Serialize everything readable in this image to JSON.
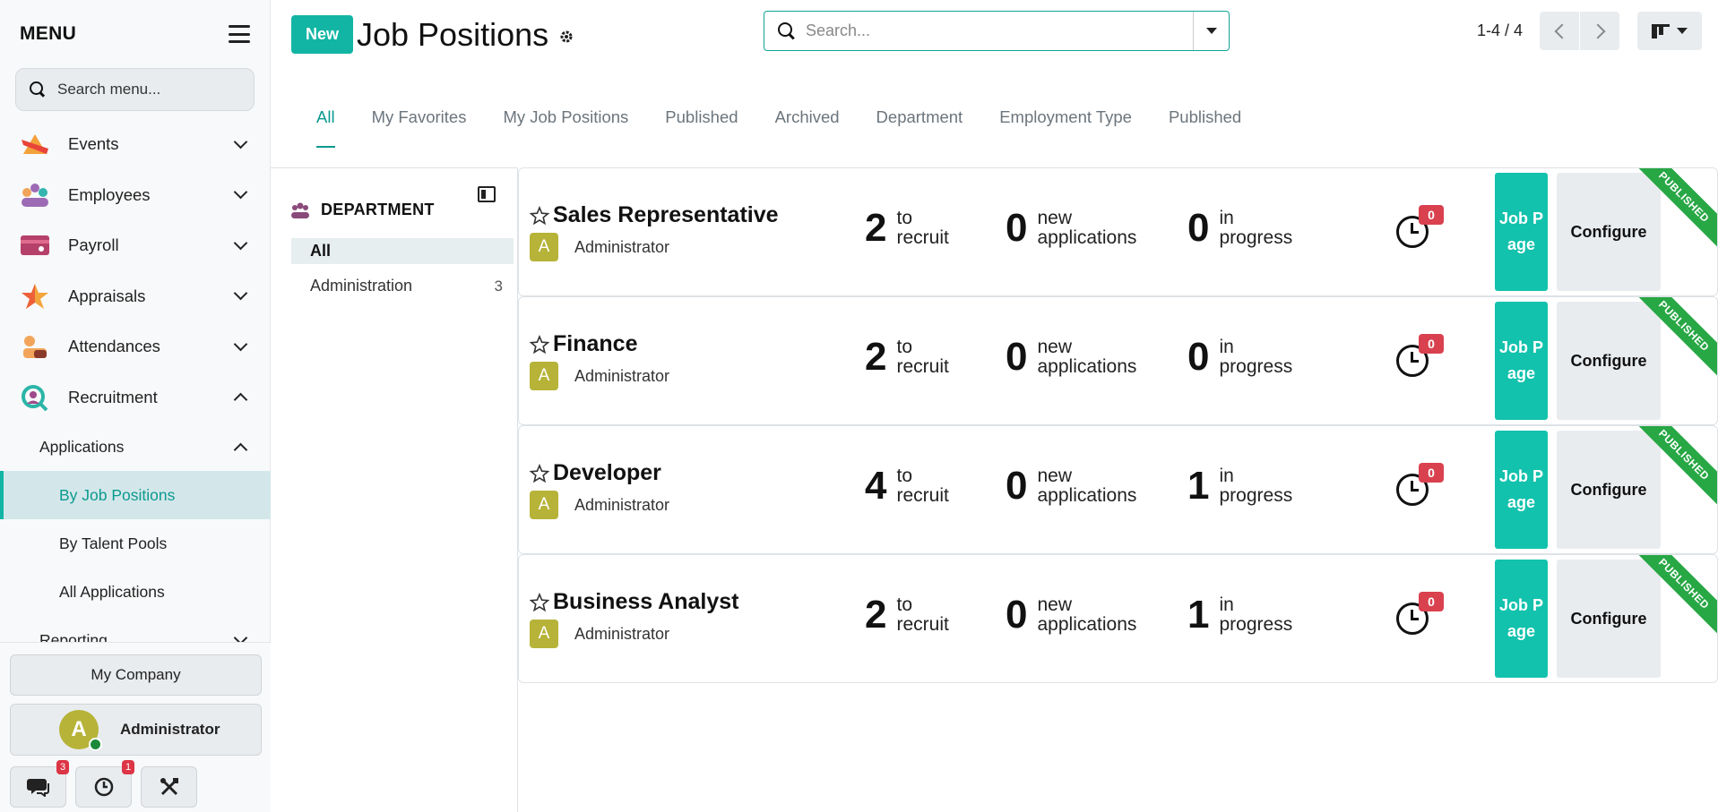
{
  "sidebar": {
    "title": "MENU",
    "search_placeholder": "Search menu...",
    "apps": [
      {
        "label": "Events",
        "icon": "events-icon"
      },
      {
        "label": "Employees",
        "icon": "employees-icon"
      },
      {
        "label": "Payroll",
        "icon": "payroll-icon"
      },
      {
        "label": "Appraisals",
        "icon": "appraisals-icon"
      },
      {
        "label": "Attendances",
        "icon": "attendances-icon"
      },
      {
        "label": "Recruitment",
        "icon": "recruitment-icon"
      }
    ],
    "applications_label": "Applications",
    "sub_items": [
      "By Job Positions",
      "By Talent Pools",
      "All Applications"
    ],
    "reporting_label": "Reporting",
    "company": "My Company",
    "user": "Administrator",
    "user_initial": "A",
    "messages_count": "3",
    "activities_count": "1"
  },
  "topbar": {
    "new_label": "New",
    "title": "Job Positions",
    "search_placeholder": "Search...",
    "pager": "1-4 / 4"
  },
  "filters": [
    "All",
    "My Favorites",
    "My Job Positions",
    "Published",
    "Archived",
    "Department",
    "Employment Type",
    "Published"
  ],
  "department_panel": {
    "heading": "DEPARTMENT",
    "rows": [
      {
        "label": "All",
        "count": ""
      },
      {
        "label": "Administration",
        "count": "3"
      }
    ]
  },
  "labels": {
    "to_recruit_1": "to",
    "to_recruit_2": "recruit",
    "new_apps_1": "new",
    "new_apps_2": "applications",
    "in_progress_1": "in",
    "in_progress_2": "progress",
    "job_page": "Job Page",
    "configure": "Configure",
    "ribbon": "PUBLISHED"
  },
  "jobs": [
    {
      "title": "Sales Representative",
      "owner": "Administrator",
      "owner_initial": "A",
      "to_recruit": "2",
      "new_applications": "0",
      "in_progress": "0",
      "activities": "0"
    },
    {
      "title": "Finance",
      "owner": "Administrator",
      "owner_initial": "A",
      "to_recruit": "2",
      "new_applications": "0",
      "in_progress": "0",
      "activities": "0"
    },
    {
      "title": "Developer",
      "owner": "Administrator",
      "owner_initial": "A",
      "to_recruit": "4",
      "new_applications": "0",
      "in_progress": "1",
      "activities": "0"
    },
    {
      "title": "Business Analyst",
      "owner": "Administrator",
      "owner_initial": "A",
      "to_recruit": "2",
      "new_applications": "0",
      "in_progress": "1",
      "activities": "0"
    }
  ],
  "colors": {
    "accent": "#12b5a4",
    "active_text": "#0c9a8f",
    "published_ribbon": "#28a745",
    "badge_red": "#d9414f",
    "avatar": "#b6b338"
  }
}
